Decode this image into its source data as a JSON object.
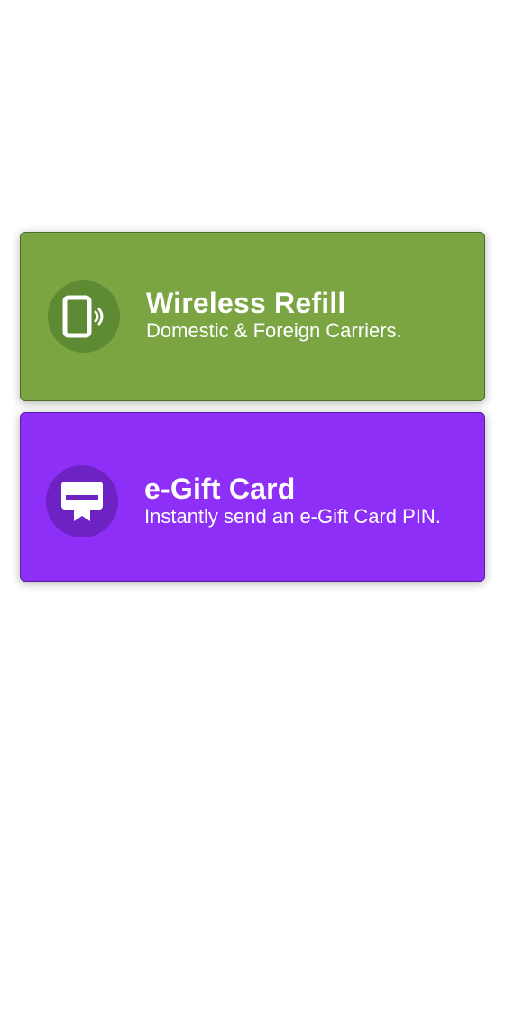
{
  "cards": [
    {
      "title": "Wireless Refill",
      "subtitle": "Domestic & Foreign Carriers.",
      "icon": "phone-wireless-icon",
      "color": "#7aa542",
      "icon_bg": "#5e8a34"
    },
    {
      "title": "e-Gift Card",
      "subtitle": "Instantly send an e-Gift Card PIN.",
      "icon": "gift-card-icon",
      "color": "#8e2ff7",
      "icon_bg": "#6d22c4"
    }
  ]
}
